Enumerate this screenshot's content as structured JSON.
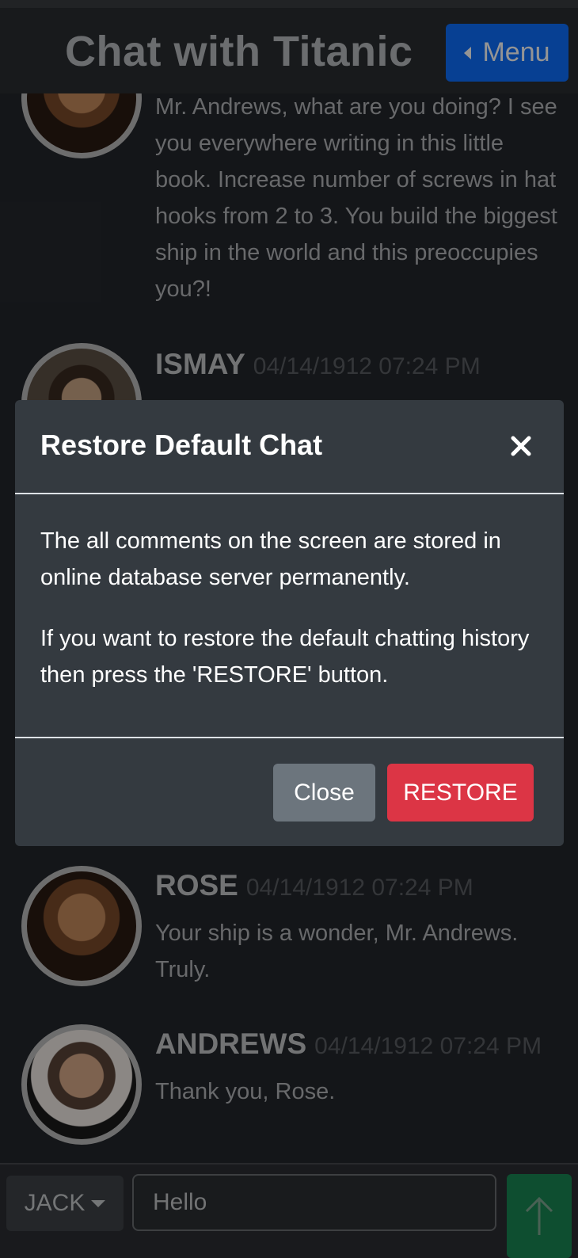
{
  "header": {
    "title": "Chat with Titanic",
    "menu_label": "Menu"
  },
  "messages": [
    {
      "name": "",
      "time": "",
      "avatar": "rose-avatar",
      "text": "Mr. Andrews, what are you doing? I see you everywhere writing in this little book. Increase number of screws in hat hooks from 2 to 3. You build the biggest ship in the world and this preoccupies you?!"
    },
    {
      "name": "ISMAY",
      "time": "04/14/1912 07:24 PM",
      "avatar": "ismay-avatar",
      "text": ""
    },
    {
      "name": "ROSE",
      "time": "04/14/1912 07:24 PM",
      "avatar": "rose-avatar",
      "text": "Your ship is a wonder, Mr. Andrews. Truly."
    },
    {
      "name": "ANDREWS",
      "time": "04/14/1912 07:24 PM",
      "avatar": "andrews-avatar",
      "text": "Thank you, Rose."
    }
  ],
  "footer": {
    "sender": "JACK",
    "input_value": "Hello",
    "send_icon": "arrow-up-icon"
  },
  "modal": {
    "title": "Restore Default Chat",
    "body_p1": "The all comments on the screen are stored in online database server permanently.",
    "body_p2": "If you want to restore the default chatting history then press the 'RESTORE' button.",
    "close_label": "Close",
    "restore_label": "RESTORE"
  },
  "colors": {
    "menu_button": "#0d6efd",
    "send_button": "#198754",
    "restore_button": "#dc3545",
    "close_button": "#6c757d",
    "modal_background": "#343a40"
  }
}
